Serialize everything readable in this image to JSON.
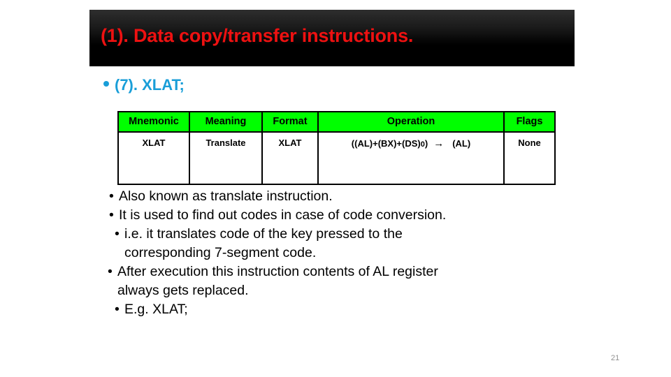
{
  "slide": {
    "title": "(1). Data copy/transfer instructions.",
    "subheading": "(7). XLAT;",
    "page_number": "21"
  },
  "colors": {
    "title_text": "#ee1111",
    "banner_background": "#000000",
    "subheading_text": "#199ed8",
    "table_header_background": "#00ff00",
    "table_header_text": "#000000",
    "body_text": "#000000",
    "page_number_text": "#909090"
  },
  "table": {
    "headers": {
      "mnemonic": "Mnemonic",
      "meaning": "Meaning",
      "format": "Format",
      "operation": "Operation",
      "flags": "Flags"
    },
    "rows": [
      {
        "mnemonic": "XLAT",
        "meaning": "Translate",
        "format": "XLAT",
        "operation_left": "((AL)+(BX)+(DS)",
        "operation_sub": "0",
        "operation_close": ")",
        "operation_arrow": "→",
        "operation_right": "(AL)",
        "flags": "None"
      }
    ]
  },
  "bullets": {
    "marker": "•",
    "items": [
      {
        "line1": "Also known as translate instruction.",
        "line2": ""
      },
      {
        "line1": "It is used to find out codes in case of code conversion.",
        "line2": ""
      },
      {
        "line1": "i.e. it translates code of the key pressed to the",
        "line2": "corresponding 7-segment code."
      },
      {
        "line1": "After execution this instruction contents of AL register",
        "line2": "always gets replaced."
      },
      {
        "line1": "E.g. XLAT;",
        "line2": ""
      }
    ]
  }
}
